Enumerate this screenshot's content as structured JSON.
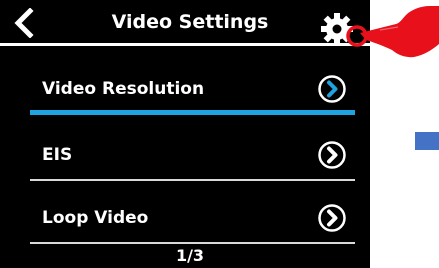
{
  "header": {
    "title": "Video Settings",
    "back_icon": "back-chevron-icon",
    "settings_icon": "gear-icon"
  },
  "menu": {
    "items": [
      {
        "label": "Video Resolution",
        "icon": "chevron-right-circle-icon",
        "selected": true
      },
      {
        "label": "EIS",
        "icon": "chevron-right-circle-icon",
        "selected": false
      },
      {
        "label": "Loop Video",
        "icon": "chevron-right-circle-icon",
        "selected": false
      }
    ]
  },
  "pagination": {
    "text": "1/3"
  },
  "colors": {
    "screen_bg": "#000000",
    "accent": "#1ea2e0",
    "text": "#ffffff",
    "pointer_red": "#e8101a"
  },
  "overlay": {
    "pointer_icon": "hand-pointer-icon"
  }
}
